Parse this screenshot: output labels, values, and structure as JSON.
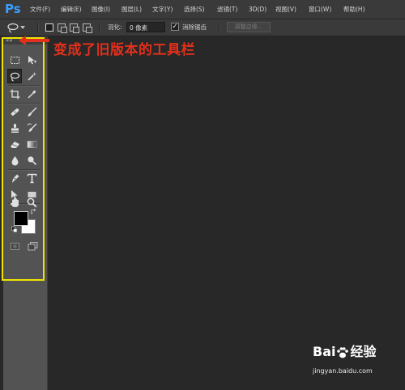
{
  "app": {
    "logo": "Ps",
    "accent_color": "#3b9eff"
  },
  "menu": {
    "items": [
      {
        "label": "文件(F)"
      },
      {
        "label": "编辑(E)"
      },
      {
        "label": "图像(I)"
      },
      {
        "label": "图层(L)"
      },
      {
        "label": "文字(Y)"
      },
      {
        "label": "选择(S)"
      },
      {
        "label": "滤镜(T)"
      },
      {
        "label": "3D(D)"
      },
      {
        "label": "视图(V)"
      },
      {
        "label": "窗口(W)"
      },
      {
        "label": "帮助(H)"
      }
    ]
  },
  "options": {
    "current_tool_icon": "lasso-icon",
    "selection_modes": [
      "new-selection-icon",
      "add-selection-icon",
      "subtract-selection-icon",
      "intersect-selection-icon"
    ],
    "feather_label": "羽化:",
    "feather_value": "0 像素",
    "antialias_label": "消除锯齿",
    "antialias_checked": "✓",
    "refine_edge_label": "调整边缘..."
  },
  "toolbox": {
    "collapse_label": "««",
    "tools": [
      "rectangular-marquee-icon",
      "move-icon",
      "lasso-icon",
      "magic-wand-icon",
      "crop-icon",
      "eyedropper-icon",
      "healing-brush-icon",
      "brush-icon",
      "clone-stamp-icon",
      "history-brush-icon",
      "eraser-icon",
      "gradient-icon",
      "blur-icon",
      "dodge-icon",
      "pen-icon",
      "type-icon",
      "path-selection-icon",
      "rectangle-shape-icon",
      "hand-icon",
      "zoom-icon"
    ],
    "selected_tool": "lasso-icon",
    "foreground_color": "#000000",
    "background_color": "#ffffff",
    "highlight_color": "#f2e400"
  },
  "annotation": {
    "text": "变成了旧版本的工具栏",
    "color": "#e3301c"
  },
  "watermark": {
    "brand": "Bai",
    "brand_suffix": "经验",
    "url": "jingyan.baidu.com"
  }
}
